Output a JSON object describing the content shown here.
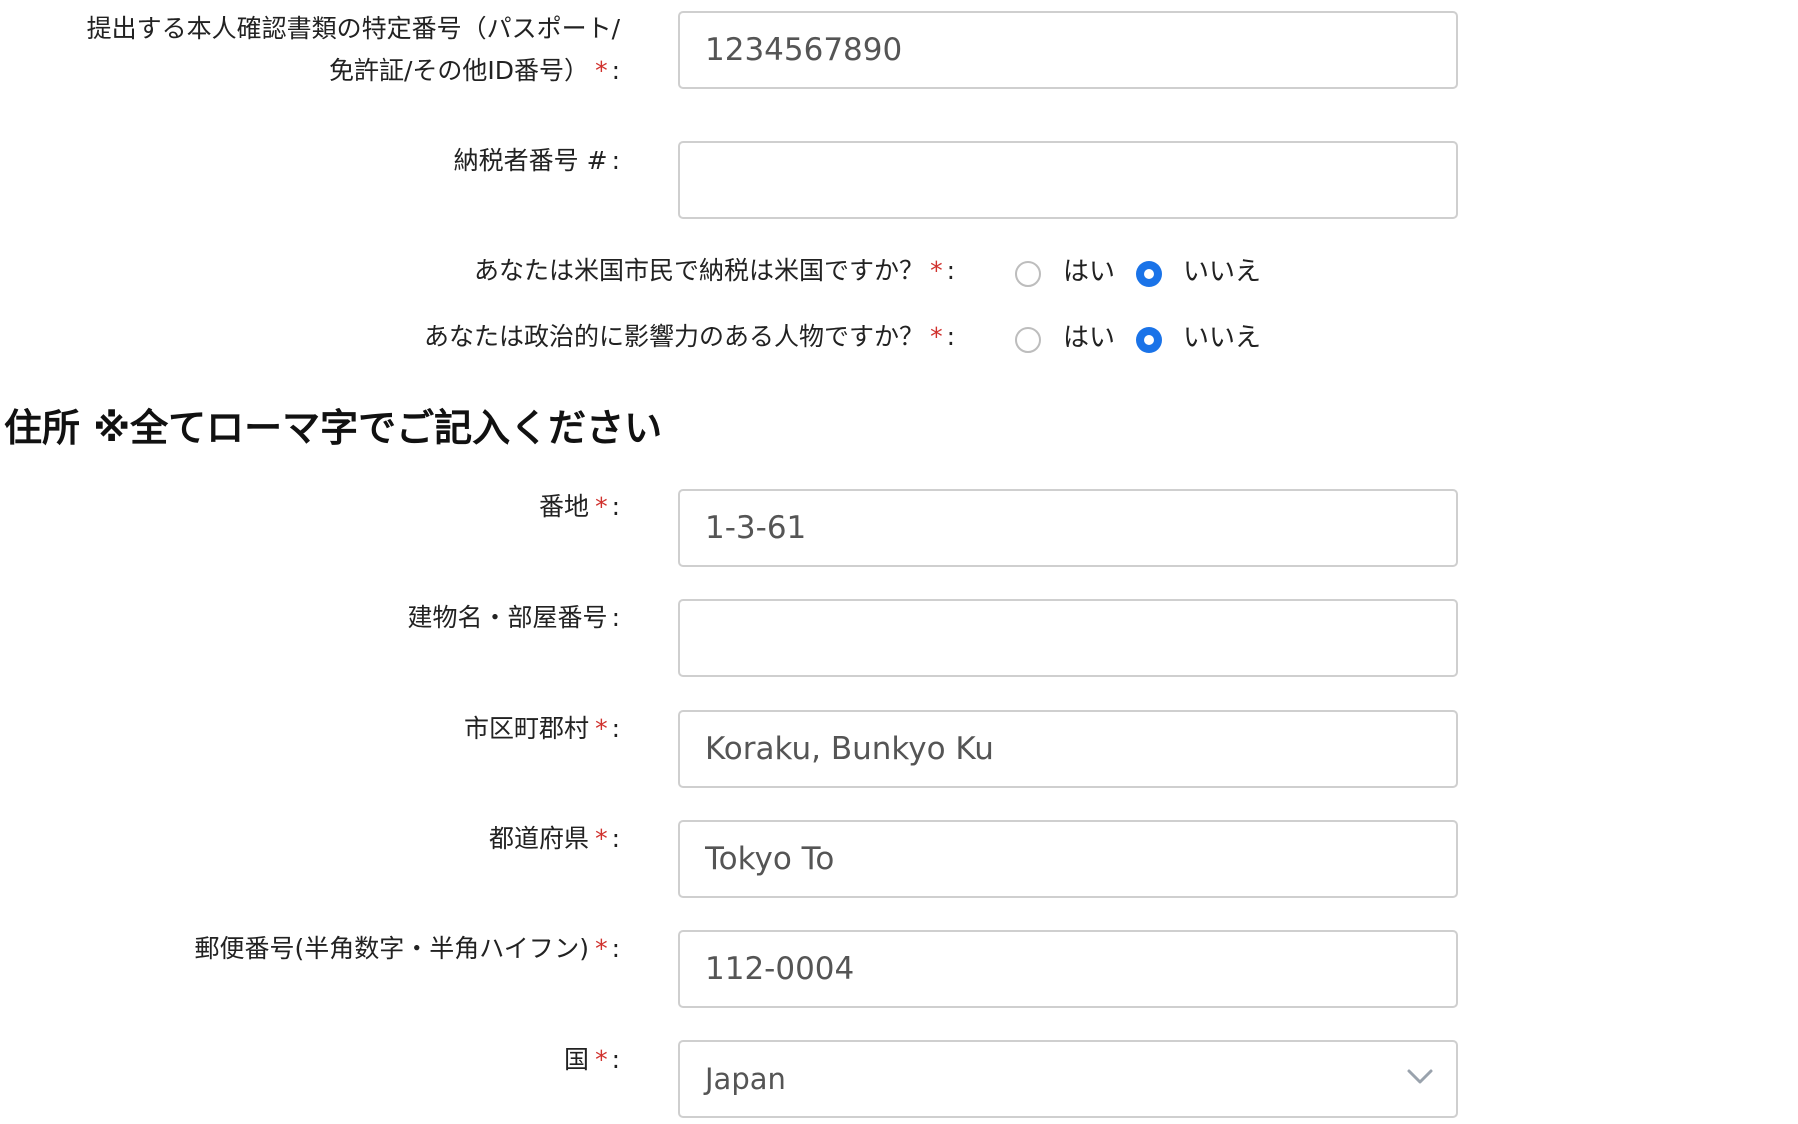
{
  "fields": {
    "id_number": {
      "label_line1": "提出する本人確認書類の特定番号（パスポート/",
      "label_line2": "免許証/その他ID番号）",
      "required_mark": "*",
      "colon": ":",
      "value": "1234567890"
    },
    "taxpayer_number": {
      "label": "納税者番号 #",
      "colon": ":",
      "value": ""
    }
  },
  "questions": {
    "us_citizen": {
      "label": "あなたは米国市民で納税は米国ですか？",
      "required_mark": "*",
      "colon": ":",
      "options": [
        "はい",
        "いいえ"
      ],
      "selected": "いいえ"
    },
    "pep": {
      "label": "あなたは政治的に影響力のある人物ですか？",
      "required_mark": "*",
      "colon": ":",
      "options": [
        "はい",
        "いいえ"
      ],
      "selected": "いいえ"
    }
  },
  "address": {
    "section_title": "住所 ※全てローマ字でご記入ください",
    "street": {
      "label": "番地",
      "required_mark": "*",
      "colon": ":",
      "value": "1-3-61"
    },
    "building": {
      "label": "建物名・部屋番号",
      "colon": ":",
      "value": ""
    },
    "city": {
      "label": "市区町郡村",
      "required_mark": "*",
      "colon": ":",
      "value": "Koraku, Bunkyo Ku"
    },
    "prefecture": {
      "label": "都道府県",
      "required_mark": "*",
      "colon": ":",
      "value": "Tokyo To"
    },
    "postal_code": {
      "label": "郵便番号(半角数字・半角ハイフン)",
      "required_mark": "*",
      "colon": ":",
      "value": "112-0004"
    },
    "country": {
      "label": "国",
      "required_mark": "*",
      "colon": ":",
      "selected": "Japan"
    }
  },
  "colors": {
    "accent": "#1a73e8",
    "required": "#d0312d",
    "border": "#cfcfcf"
  }
}
